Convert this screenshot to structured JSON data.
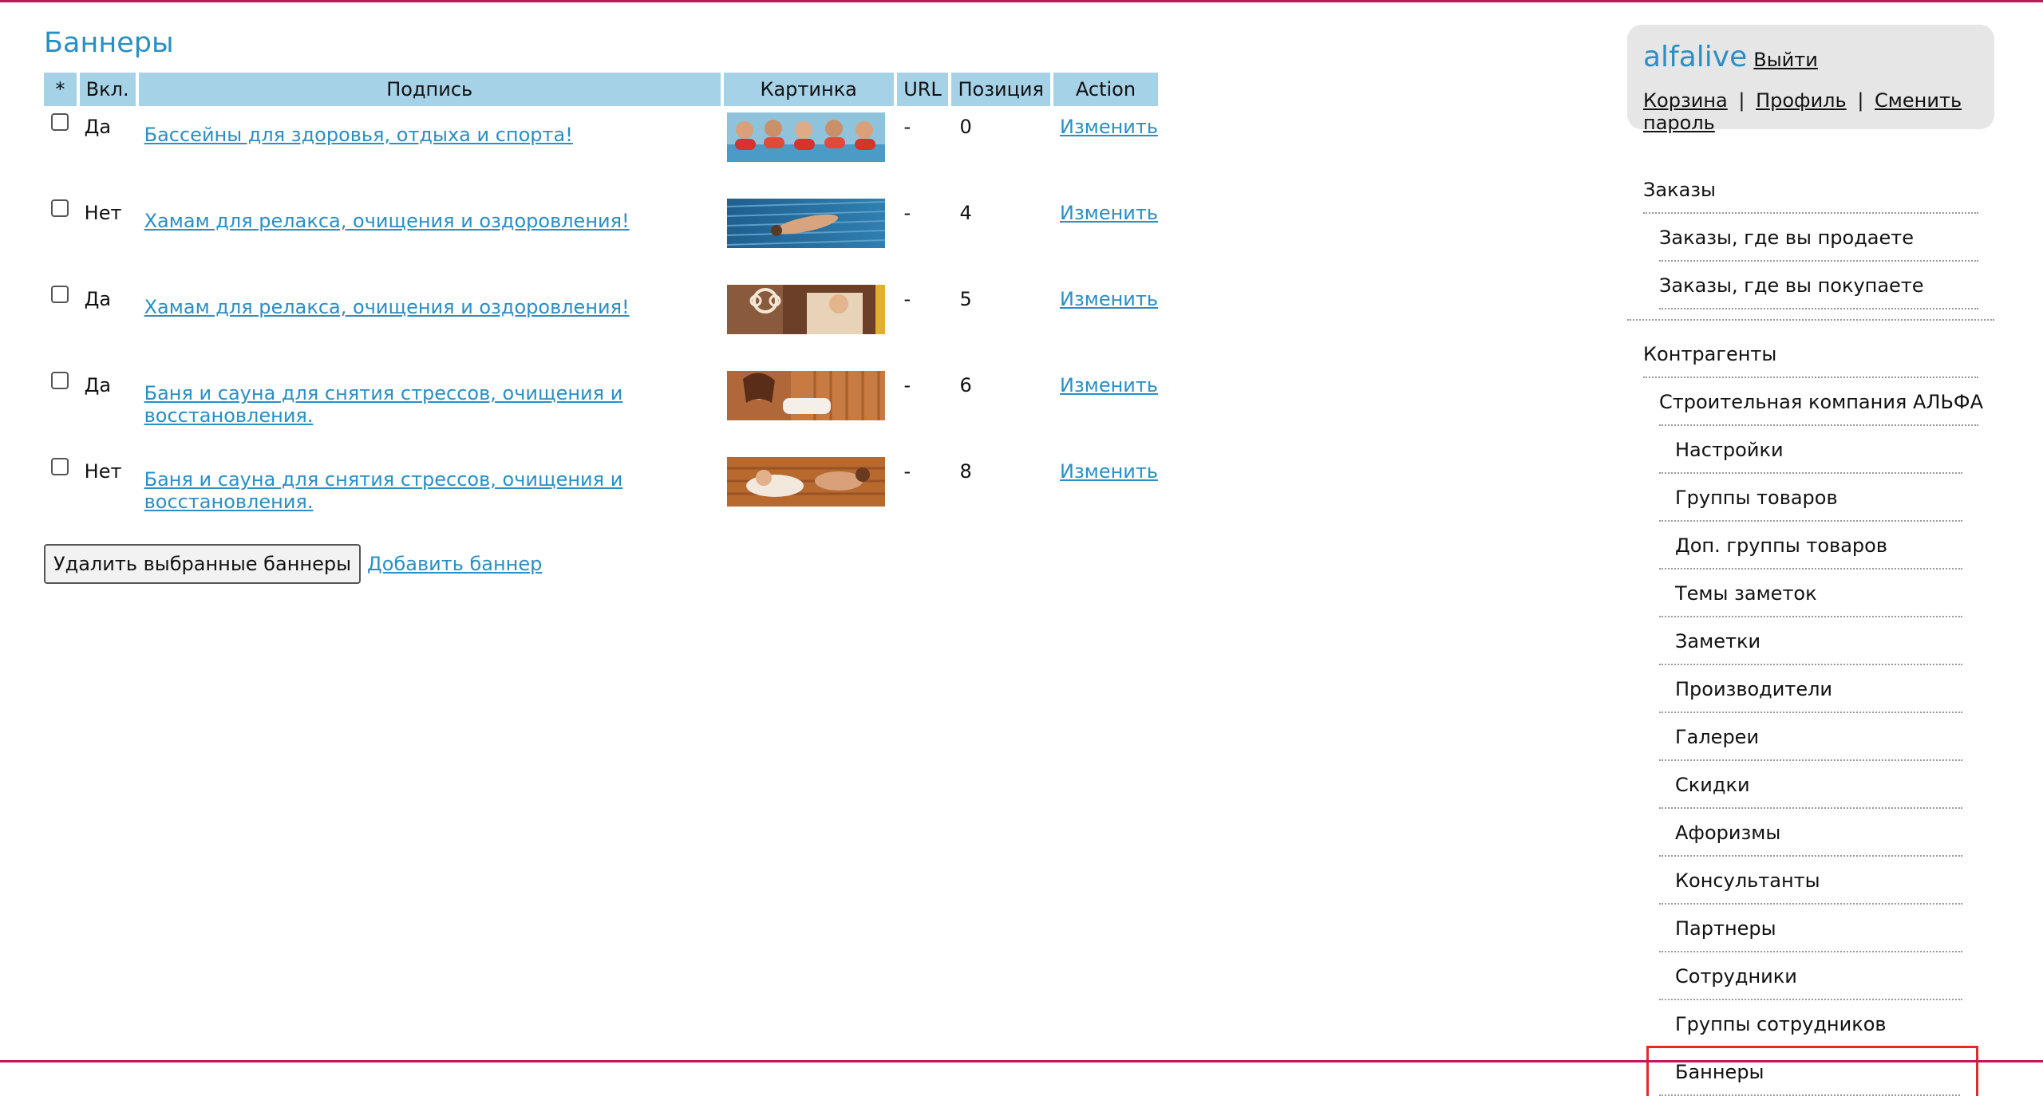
{
  "page": {
    "title": "Баннеры"
  },
  "table": {
    "headers": [
      "*",
      "Вкл.",
      "Подпись",
      "Картинка",
      "URL",
      "Позиция",
      "Action"
    ],
    "rows": [
      {
        "enabled": "Да",
        "caption": "Бассейны для здоровья, отдыха и спорта!",
        "url": "-",
        "position": "0",
        "action": "Изменить",
        "image_icon": "pool-kids-image"
      },
      {
        "enabled": "Нет",
        "caption": "Хамам для релакса, очищения и оздоровления!",
        "url": "-",
        "position": "4",
        "action": "Изменить",
        "image_icon": "hamam-pool-image"
      },
      {
        "enabled": "Да",
        "caption": "Хамам для релакса, очищения и оздоровления!",
        "url": "-",
        "position": "5",
        "action": "Изменить",
        "image_icon": "hamam-ornament-image"
      },
      {
        "enabled": "Да",
        "caption": "Баня и сауна для снятия стрессов, очищения и восстановления.",
        "url": "-",
        "position": "6",
        "action": "Изменить",
        "image_icon": "sauna-woman-image"
      },
      {
        "enabled": "Нет",
        "caption": "Баня и сауна для снятия стрессов, очищения и восстановления.",
        "url": "-",
        "position": "8",
        "action": "Изменить",
        "image_icon": "sauna-relax-image"
      }
    ]
  },
  "actions": {
    "delete_label": "Удалить выбранные баннеры",
    "add_label": "Добавить баннер"
  },
  "user": {
    "name": "alfalive",
    "logout": "Выйти",
    "cart": "Корзина",
    "profile": "Профиль",
    "change_password": "Сменить пароль",
    "separator": "|"
  },
  "menu": {
    "orders": {
      "title": "Заказы",
      "items": [
        "Заказы, где вы продаете",
        "Заказы, где вы покупаете"
      ]
    },
    "contractors": {
      "title": "Контрагенты",
      "company": "Строительная компания АЛЬФА",
      "items": [
        "Настройки",
        "Группы товаров",
        "Доп. группы товаров",
        "Темы заметок",
        "Заметки",
        "Производители",
        "Галереи",
        "Скидки",
        "Афоризмы",
        "Консультанты",
        "Партнеры",
        "Сотрудники",
        "Группы сотрудников",
        "Баннеры"
      ],
      "active": "Баннеры"
    }
  },
  "colors": {
    "accent": "#2a8fc4",
    "header_bg": "#a6d2e8",
    "highlight": "#e02c2c",
    "frame": "#c2185b"
  }
}
